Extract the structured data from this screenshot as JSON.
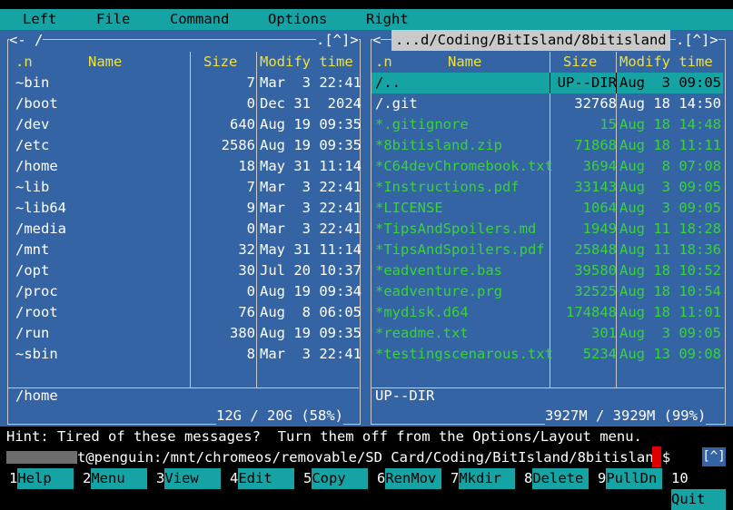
{
  "menu": [
    "Left",
    "File",
    "Command",
    "Options",
    "Right"
  ],
  "left_panel": {
    "path": "<- /",
    "controls": ".[^]>",
    "headers": {
      "n": ".n",
      "name": "Name",
      "size": "Size",
      "modify": "Modify time"
    },
    "files": [
      {
        "name": "~bin",
        "size": "7",
        "time": "Mar  3 22:41"
      },
      {
        "name": "/boot",
        "size": "0",
        "time": "Dec 31  2024"
      },
      {
        "name": "/dev",
        "size": "640",
        "time": "Aug 19 09:35"
      },
      {
        "name": "/etc",
        "size": "2586",
        "time": "Aug 19 09:35"
      },
      {
        "name": "/home",
        "size": "18",
        "time": "May 31 11:14"
      },
      {
        "name": "~lib",
        "size": "7",
        "time": "Mar  3 22:41"
      },
      {
        "name": "~lib64",
        "size": "9",
        "time": "Mar  3 22:41"
      },
      {
        "name": "/media",
        "size": "0",
        "time": "Mar  3 22:41"
      },
      {
        "name": "/mnt",
        "size": "32",
        "time": "May 31 11:14"
      },
      {
        "name": "/opt",
        "size": "30",
        "time": "Jul 20 10:37"
      },
      {
        "name": "/proc",
        "size": "0",
        "time": "Aug 19 09:34"
      },
      {
        "name": "/root",
        "size": "76",
        "time": "Aug  8 06:05"
      },
      {
        "name": "/run",
        "size": "380",
        "time": "Aug 19 09:35"
      },
      {
        "name": "~sbin",
        "size": "8",
        "time": "Mar  3 22:41"
      }
    ],
    "mini_status": "/home",
    "disk": "12G / 20G (58%)"
  },
  "right_panel": {
    "path": "...d/Coding/BitIsland/8bitisland",
    "controls": ".[^]>",
    "headers": {
      "n": ".n",
      "name": "Name",
      "size": "Size",
      "modify": "Modify time"
    },
    "files": [
      {
        "name": "/..",
        "size": "UP--DIR",
        "time": "Aug  3 09:05",
        "cursor": true
      },
      {
        "name": "/.git",
        "size": "32768",
        "time": "Aug 18 14:50"
      },
      {
        "name": "*.gitignore",
        "size": "15",
        "time": "Aug 18 14:48",
        "exec": true
      },
      {
        "name": "*8bitisland.zip",
        "size": "71868",
        "time": "Aug 18 11:11",
        "exec": true
      },
      {
        "name": "*C64devChromebook.txt",
        "size": "3694",
        "time": "Aug  8 07:08",
        "exec": true
      },
      {
        "name": "*Instructions.pdf",
        "size": "33143",
        "time": "Aug  3 09:05",
        "exec": true
      },
      {
        "name": "*LICENSE",
        "size": "1064",
        "time": "Aug  3 09:05",
        "exec": true
      },
      {
        "name": "*TipsAndSpoilers.md",
        "size": "1949",
        "time": "Aug 11 18:28",
        "exec": true
      },
      {
        "name": "*TipsAndSpoilers.pdf",
        "size": "25848",
        "time": "Aug 11 18:36",
        "exec": true
      },
      {
        "name": "*eadventure.bas",
        "size": "39580",
        "time": "Aug 18 10:52",
        "exec": true
      },
      {
        "name": "*eadventure.prg",
        "size": "32525",
        "time": "Aug 18 10:54",
        "exec": true
      },
      {
        "name": "*mydisk.d64",
        "size": "174848",
        "time": "Aug 18 11:01",
        "exec": true
      },
      {
        "name": "*readme.txt",
        "size": "301",
        "time": "Aug  3 09:05",
        "exec": true
      },
      {
        "name": "*testingscenarous.txt",
        "size": "5234",
        "time": "Aug 13 09:08",
        "exec": true
      }
    ],
    "mini_status": "UP--DIR",
    "disk": "3927M / 3929M (99%)"
  },
  "hint": "Hint: Tired of these messages?  Turn them off from the Options/Layout menu.",
  "prompt": {
    "host_path": "t@penguin:/mnt/chromeos/removable/SD Card/Coding/BitIsland/8bitisland$"
  },
  "caret_button": "[^]",
  "fkeys": [
    {
      "num": "1",
      "label": "Help"
    },
    {
      "num": "2",
      "label": "Menu"
    },
    {
      "num": "3",
      "label": "View"
    },
    {
      "num": "4",
      "label": "Edit"
    },
    {
      "num": "5",
      "label": "Copy"
    },
    {
      "num": "6",
      "label": "RenMov"
    },
    {
      "num": "7",
      "label": "Mkdir"
    },
    {
      "num": "8",
      "label": "Delete"
    },
    {
      "num": "9",
      "label": "PullDn"
    },
    {
      "num": "10",
      "label": "Quit"
    }
  ],
  "colors": {
    "panel": "#3464a4",
    "accent": "#16a3a3",
    "header": "#f0e040",
    "exec": "#3ad23a",
    "cursor": "#e00000"
  }
}
